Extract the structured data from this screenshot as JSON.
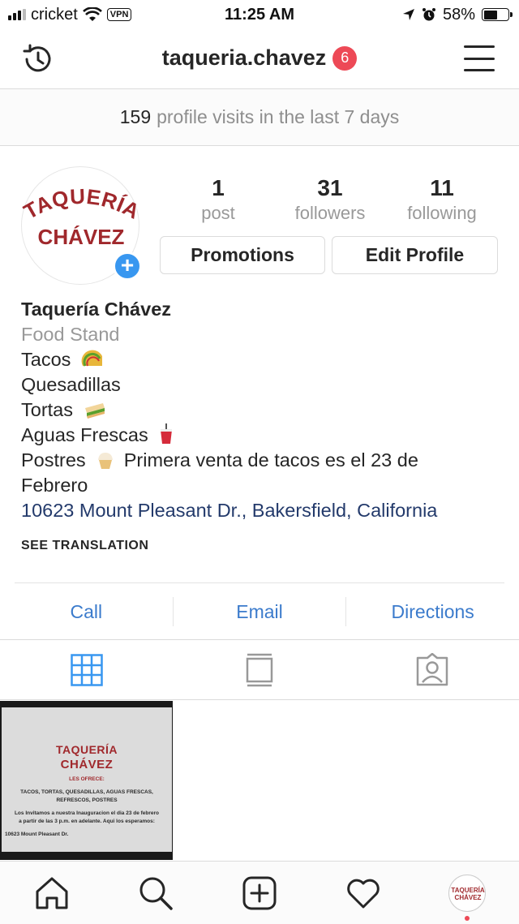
{
  "status_bar": {
    "carrier": "cricket",
    "vpn": "VPN",
    "time": "11:25 AM",
    "battery": "58%",
    "battery_level": 0.58
  },
  "header": {
    "username": "taqueria.chavez",
    "notification_count": "6",
    "icons": {
      "left": "history-icon",
      "right": "menu-icon"
    }
  },
  "visits": {
    "count": "159",
    "text": "profile visits in the last 7 days"
  },
  "profile": {
    "logo_line1": "TAQUERÍA",
    "logo_line2": "CHÁVEZ",
    "stats": [
      {
        "number": "1",
        "label": "post"
      },
      {
        "number": "31",
        "label": "followers"
      },
      {
        "number": "11",
        "label": "following"
      }
    ],
    "buttons": {
      "promotions": "Promotions",
      "edit_profile": "Edit Profile"
    },
    "name": "Taquería Chávez",
    "category": "Food Stand",
    "bio_lines": [
      {
        "text": "Tacos",
        "emoji": "taco"
      },
      {
        "text": "Quesadillas"
      },
      {
        "text": "Tortas",
        "emoji": "sandwich"
      },
      {
        "text": "Aguas Frescas",
        "emoji": "cup"
      },
      {
        "text": "Postres",
        "emoji": "cupcake",
        "after": "Primera venta de tacos es el 23 de"
      },
      {
        "text": "Febrero"
      }
    ],
    "address": "10623 Mount Pleasant Dr., Bakersfield, California",
    "see_translation": "SEE TRANSLATION"
  },
  "contact": {
    "call": "Call",
    "email": "Email",
    "directions": "Directions"
  },
  "tabs": [
    {
      "icon": "grid-icon",
      "active": true
    },
    {
      "icon": "feed-icon",
      "active": false
    },
    {
      "icon": "tagged-icon",
      "active": false
    }
  ],
  "post": {
    "title1": "TAQUERÍA",
    "title2": "CHÁVEZ",
    "subtitle": "LES OFRECE:",
    "items1": "TACOS, TORTAS, QUESADILLAS, AGUAS FRESCAS,",
    "items2": "REFRESCOS, POSTRES",
    "invite1": "Los Invitamos a nuestra Inauguracion el dia 23 de febrero",
    "invite2": "a partir de las 3 p.m. en adelante. Aqui los esperamos:",
    "address": "10623 Mount Pleasant Dr."
  },
  "bottom_nav": [
    "home-icon",
    "search-icon",
    "new-post-icon",
    "activity-icon",
    "profile-icon"
  ],
  "colors": {
    "accent": "#3897f0",
    "link": "#3b7bcc",
    "badge": "#ed4956",
    "brand_red": "#a0282c"
  }
}
